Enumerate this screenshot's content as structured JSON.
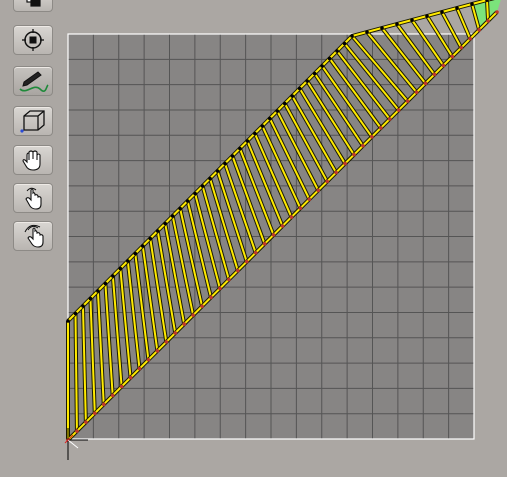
{
  "app": {
    "title": "",
    "colors": {
      "background": "#aba7a3",
      "grid_area": "#878584",
      "grid_line": "#555555",
      "grid_border": "#ffffff",
      "segment_fill": "#ffea00",
      "segment_edge": "#1a1a00",
      "selected_segment": "#7be37b",
      "top_points": "#000000",
      "bottom_points": "#c0392b"
    }
  },
  "toolbar": {
    "tools": [
      {
        "id": "layers",
        "icon": "layers-icon",
        "active": false
      },
      {
        "id": "center",
        "icon": "crosshair-target-icon",
        "active": false
      },
      {
        "id": "draw",
        "icon": "pencil-curve-icon",
        "active": true
      },
      {
        "id": "box",
        "icon": "cube-icon",
        "active": false
      },
      {
        "id": "hand",
        "icon": "hand-pan-icon",
        "active": false
      },
      {
        "id": "tap",
        "icon": "hand-tap-icon",
        "active": false
      },
      {
        "id": "multi-tap",
        "icon": "hand-multi-tap-icon",
        "active": false
      }
    ]
  },
  "canvas": {
    "grid_divisions": 16,
    "segment_count": 48,
    "selected_segment_index": 47,
    "origin_marker": "axes-origin-icon"
  }
}
